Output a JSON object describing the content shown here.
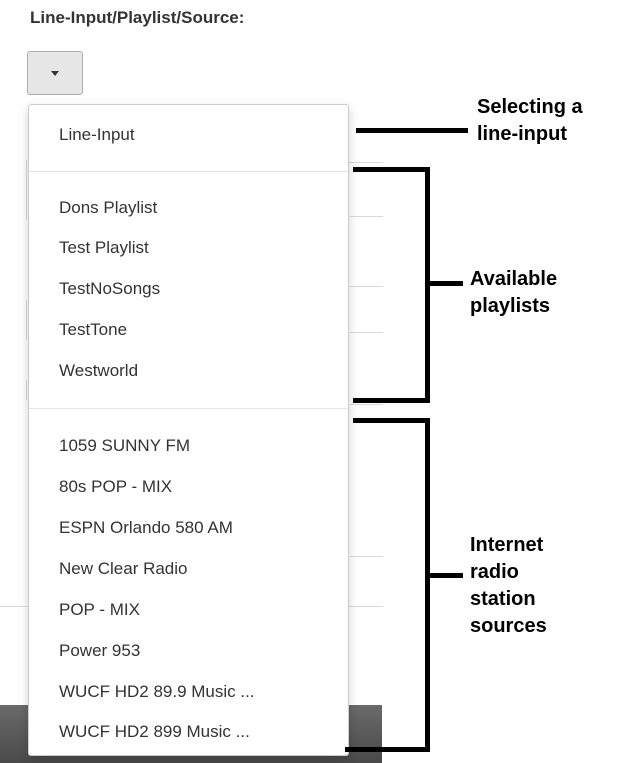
{
  "field": {
    "label": "Line-Input/Playlist/Source:"
  },
  "menu": {
    "line_input": [
      "Line-Input"
    ],
    "playlists": [
      "Dons Playlist",
      "Test Playlist",
      "TestNoSongs",
      "TestTone",
      "Westworld"
    ],
    "stations": [
      "1059 SUNNY FM",
      "80s POP - MIX",
      "ESPN Orlando 580 AM",
      "New Clear Radio",
      "POP - MIX",
      "Power 953",
      "WUCF HD2 89.9 Music ...",
      "WUCF HD2 899 Music ..."
    ]
  },
  "annotations": {
    "line_input": [
      "Selecting a",
      "line-input"
    ],
    "playlists": [
      "Available",
      "playlists"
    ],
    "stations": [
      "Internet",
      "radio",
      "station",
      "sources"
    ]
  }
}
